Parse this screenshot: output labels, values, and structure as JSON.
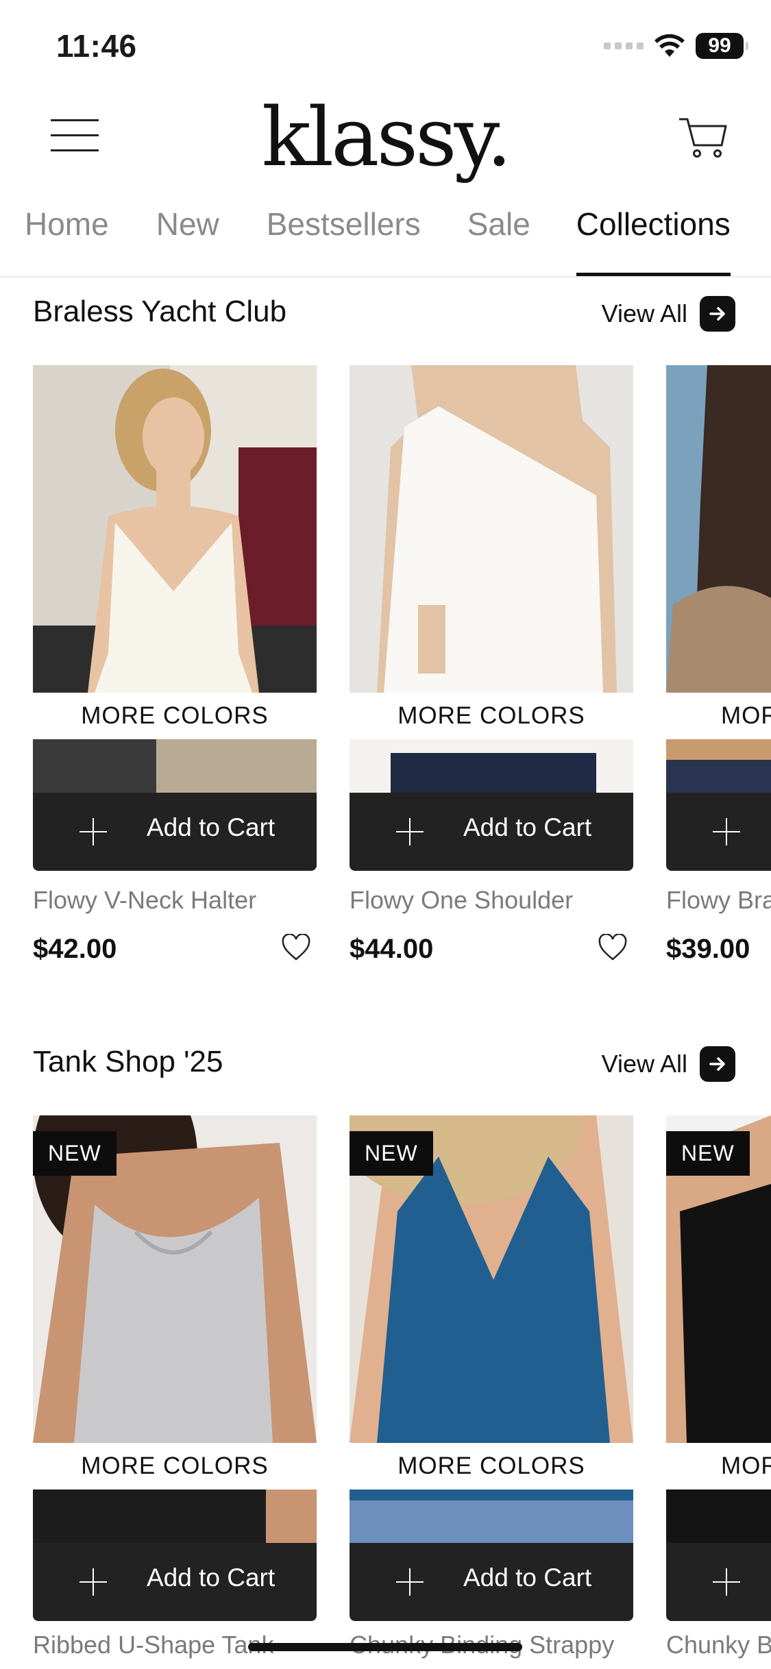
{
  "status_bar": {
    "time": "11:46",
    "battery": "99"
  },
  "header": {
    "logo": "klassy."
  },
  "tabs": [
    {
      "label": "Home",
      "active": false
    },
    {
      "label": "New",
      "active": false
    },
    {
      "label": "Bestsellers",
      "active": false
    },
    {
      "label": "Sale",
      "active": false
    },
    {
      "label": "Collections",
      "active": true
    }
  ],
  "sections": [
    {
      "title": "Braless Yacht Club",
      "view_all": "View All",
      "products": [
        {
          "name": "Flowy V-Neck Halter",
          "price": "$42.00",
          "more_colors": "MORE COLORS",
          "add_to_cart": "Add to Cart",
          "badge": ""
        },
        {
          "name": "Flowy One Shoulder",
          "price": "$44.00",
          "more_colors": "MORE COLORS",
          "add_to_cart": "Add to Cart",
          "badge": ""
        },
        {
          "name": "Flowy Bra",
          "price": "$39.00",
          "more_colors": "MOR",
          "add_to_cart": "",
          "badge": ""
        }
      ]
    },
    {
      "title": "Tank Shop '25",
      "view_all": "View All",
      "products": [
        {
          "name": "Ribbed U-Shape Tank",
          "price": "",
          "more_colors": "MORE COLORS",
          "add_to_cart": "Add to Cart",
          "badge": "NEW"
        },
        {
          "name": "Chunky Binding Strappy",
          "price": "",
          "more_colors": "MORE COLORS",
          "add_to_cart": "Add to Cart",
          "badge": "NEW"
        },
        {
          "name": "Chunky B",
          "price": "",
          "more_colors": "MOR",
          "add_to_cart": "",
          "badge": "NEW"
        }
      ]
    }
  ],
  "colors": {
    "accent": "#111111",
    "button": "#222222",
    "muted_text": "#7a7a7a",
    "tab_inactive": "#8a8a8a"
  }
}
